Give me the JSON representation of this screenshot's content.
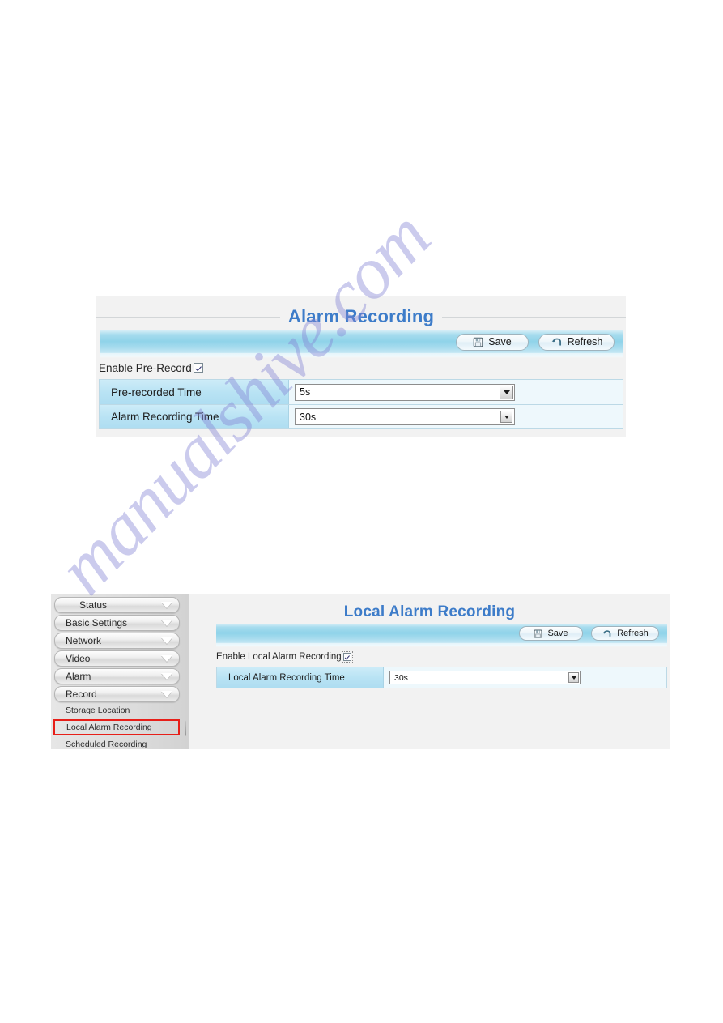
{
  "watermark": {
    "text": "manualshive.com"
  },
  "panel_top": {
    "title": "Alarm Recording",
    "toolbar": {
      "save_label": "Save",
      "save_icon": "floppy-disk-icon",
      "refresh_label": "Refresh",
      "refresh_icon": "refresh-arrow-icon"
    },
    "enable": {
      "label": "Enable Pre-Record",
      "checked": true
    },
    "rows": [
      {
        "label": "Pre-recorded Time",
        "value": "5s",
        "control": "dropdown"
      },
      {
        "label": "Alarm Recording Time",
        "value": "30s",
        "control": "dropdown"
      }
    ]
  },
  "panel_bottom": {
    "title": "Local Alarm Recording",
    "toolbar": {
      "save_label": "Save",
      "save_icon": "floppy-disk-icon",
      "refresh_label": "Refresh",
      "refresh_icon": "refresh-arrow-icon"
    },
    "enable": {
      "label": "Enable Local Alarm Recording",
      "checked": true
    },
    "rows": [
      {
        "label": "Local Alarm Recording Time",
        "value": "30s",
        "control": "dropdown"
      }
    ],
    "sidebar": {
      "menu": [
        {
          "label": "Status",
          "icon": "chevron-down-icon"
        },
        {
          "label": "Basic Settings",
          "icon": "chevron-down-icon"
        },
        {
          "label": "Network",
          "icon": "chevron-down-icon"
        },
        {
          "label": "Video",
          "icon": "chevron-down-icon"
        },
        {
          "label": "Alarm",
          "icon": "chevron-down-icon"
        },
        {
          "label": "Record",
          "icon": "chevron-down-icon"
        }
      ],
      "submenu": [
        {
          "label": "Storage Location",
          "selected": false
        },
        {
          "label": "Local Alarm Recording",
          "selected": true
        },
        {
          "label": "Scheduled Recording",
          "selected": false
        }
      ],
      "highlight_color": "#e71f19"
    }
  },
  "colors": {
    "title_blue": "#3d7cc9",
    "toolbar_blue": "#8fd3e9",
    "row_label_blue": "#b9e3f4",
    "panel_bg": "#f2f2f2",
    "sidebar_bg": "#dcdcdc"
  }
}
